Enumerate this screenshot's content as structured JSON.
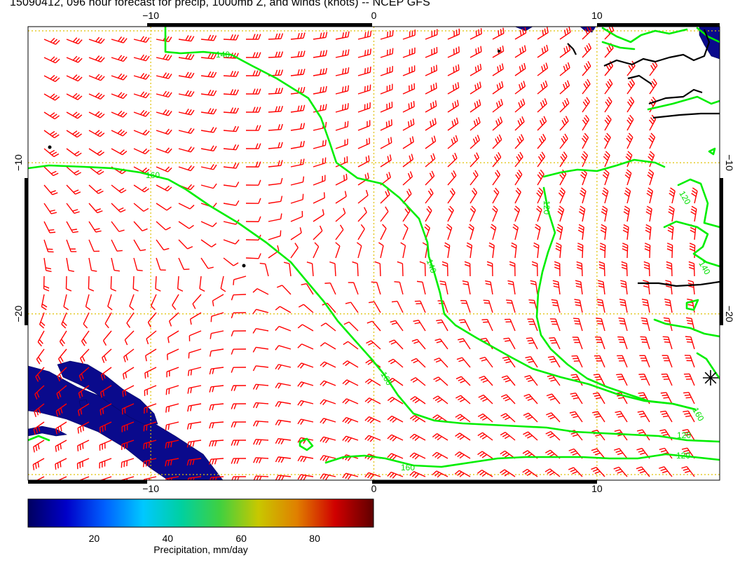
{
  "title": "15090412, 096 hour forecast for precip, 1000mb Z, and winds (knots) -- NCEP GFS",
  "map": {
    "lon_range": [
      -15.5,
      15.5
    ],
    "lat_range": [
      -31,
      -1
    ],
    "lon_ticks": [
      {
        "value": -10,
        "label": "−10"
      },
      {
        "value": 0,
        "label": "0"
      },
      {
        "value": 10,
        "label": "10"
      }
    ],
    "lat_ticks": [
      {
        "value": -10,
        "label": "−10"
      },
      {
        "value": -20,
        "label": "−20"
      }
    ],
    "gridlines": "dotted yellow at 10° intervals",
    "contour_color": "#00ee00",
    "coastline_color": "#000000",
    "wind_barb_color": "#ff0000",
    "precip_color": "#0a0a8c",
    "contour_labels": [
      "140",
      "160",
      "120",
      "140",
      "160",
      "160",
      "120",
      "140",
      "160",
      "120",
      "120"
    ],
    "cross_marker": "asterisk-icon"
  },
  "colorbar": {
    "label": "Precipitation, mm/day",
    "range": [
      2,
      96
    ],
    "ticks": [
      "20",
      "40",
      "60",
      "80"
    ],
    "tick_values": [
      20,
      40,
      60,
      80
    ],
    "colors": [
      "#000060",
      "#0000c8",
      "#0060ff",
      "#00c8ff",
      "#00d0a0",
      "#40d040",
      "#c8c800",
      "#e08000",
      "#d00000",
      "#600000"
    ]
  }
}
